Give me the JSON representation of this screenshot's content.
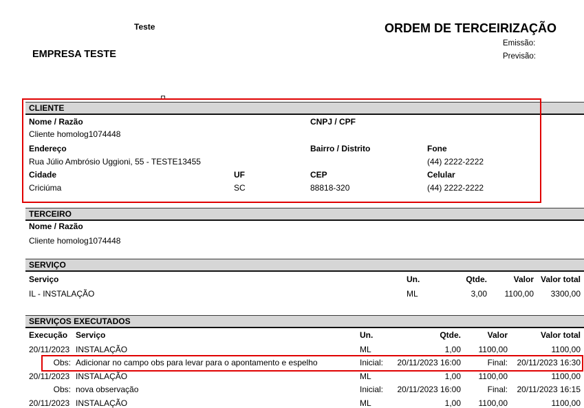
{
  "header": {
    "company_short": "Teste",
    "company_name": "EMPRESA TESTE",
    "title": "ORDEM DE TERCEIRIZAÇÃO",
    "emissao_label": "Emissão:",
    "previsao_label": "Previsão:"
  },
  "cliente": {
    "section_title": "CLIENTE",
    "nome_label": "Nome / Razão",
    "nome_value": "Cliente homolog1074448",
    "cnpj_label": "CNPJ / CPF",
    "endereco_label": "Endereço",
    "endereco_value": "Rua Júlio Ambrósio Uggioni, 55 - TESTE13455",
    "bairro_label": "Bairro / Distrito",
    "fone_label": "Fone",
    "fone_value": "(44) 2222-2222",
    "cidade_label": "Cidade",
    "cidade_value": "Criciúma",
    "uf_label": "UF",
    "uf_value": "SC",
    "cep_label": "CEP",
    "cep_value": "88818-320",
    "celular_label": "Celular",
    "celular_value": "(44) 2222-2222"
  },
  "terceiro": {
    "section_title": "TERCEIRO",
    "nome_label": "Nome / Razão",
    "nome_value": "Cliente homolog1074448"
  },
  "servico": {
    "section_title": "SERVIÇO",
    "columns": {
      "servico": "Serviço",
      "un": "Un.",
      "qtde": "Qtde.",
      "valor": "Valor",
      "valor_total": "Valor total"
    },
    "rows": [
      {
        "servico": "IL - INSTALAÇÃO",
        "un": "ML",
        "qtde": "3,00",
        "valor": "1100,00",
        "valor_total": "3300,00"
      }
    ]
  },
  "servicos_executados": {
    "section_title": "SERVIÇOS EXECUTADOS",
    "columns": {
      "execucao": "Execução",
      "servico": "Serviço",
      "un": "Un.",
      "qtde": "Qtde.",
      "valor": "Valor",
      "valor_total": "Valor total"
    },
    "rows": [
      {
        "execucao": "20/11/2023",
        "servico": "INSTALAÇÃO",
        "un": "ML",
        "qtde": "1,00",
        "valor": "1100,00",
        "valor_total": "1100,00",
        "obs_label": "Obs:",
        "obs": "Adicionar no campo obs para levar para o apontamento e espelho",
        "inicial_label": "Inicial:",
        "inicial": "20/11/2023 16:00",
        "final_label": "Final:",
        "final": "20/11/2023 16:30"
      },
      {
        "execucao": "20/11/2023",
        "servico": "INSTALAÇÃO",
        "un": "ML",
        "qtde": "1,00",
        "valor": "1100,00",
        "valor_total": "1100,00",
        "obs_label": "Obs:",
        "obs": "nova observação",
        "inicial_label": "Inicial:",
        "inicial": "20/11/2023 16:00",
        "final_label": "Final:",
        "final": "20/11/2023 16:15"
      },
      {
        "execucao": "20/11/2023",
        "servico": "INSTALAÇÃO",
        "un": "ML",
        "qtde": "1,00",
        "valor": "1100,00",
        "valor_total": "1100,00"
      }
    ]
  },
  "colors": {
    "highlight": "#e00000",
    "section_band": "#d6d6d6"
  }
}
